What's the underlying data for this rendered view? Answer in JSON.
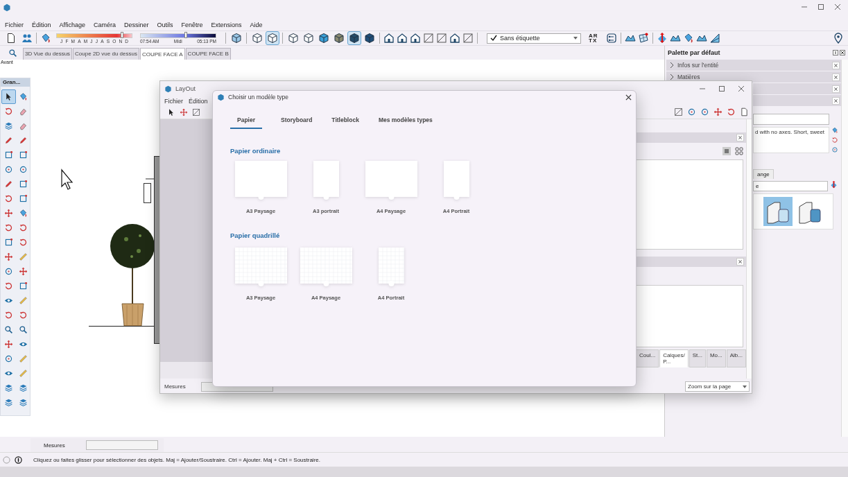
{
  "menu": [
    "Fichier",
    "Édition",
    "Affichage",
    "Caméra",
    "Dessiner",
    "Outils",
    "Fenêtre",
    "Extensions",
    "Aide"
  ],
  "sun_date": {
    "level": 0.87,
    "labels": [
      "J",
      "F",
      "M",
      "A",
      "M",
      "J",
      "J",
      "A",
      "S",
      "O",
      "N",
      "D"
    ]
  },
  "sun_time": {
    "level": 0.6,
    "labels": [
      "07:54 AM",
      "Midi",
      "05:13 PM"
    ]
  },
  "view_buttons": [
    {
      "selected": false
    },
    {
      "selected": false
    },
    {
      "selected": true
    },
    {
      "selected": false
    },
    {
      "selected": false
    },
    {
      "selected": false
    },
    {
      "selected": false
    },
    {
      "selected": true
    },
    {
      "selected": false
    }
  ],
  "tag_dropdown": {
    "value": "Sans étiquette"
  },
  "artx_label": [
    "AR",
    "TX"
  ],
  "scene_tabs": [
    {
      "label": "3D Vue du dessus",
      "selected": false
    },
    {
      "label": "Coupe 2D vue du dessus",
      "selected": false
    },
    {
      "label": "COUPE FACE A",
      "selected": true
    },
    {
      "label": "COUPE FACE B",
      "selected": false
    }
  ],
  "view_name": "Avant",
  "tool_palette": {
    "title": "Gran...",
    "tools": [
      {
        "kind": "cursor",
        "selected": true
      },
      {
        "kind": "paint",
        "selected": false
      },
      {
        "kind": "rotate",
        "selected": false
      },
      {
        "kind": "eraser",
        "selected": false
      },
      {
        "kind": "layers",
        "selected": false
      },
      {
        "kind": "eraser",
        "selected": false
      },
      {
        "kind": "pencil",
        "selected": false
      },
      {
        "kind": "pencil",
        "selected": false
      },
      {
        "kind": "rect",
        "selected": false
      },
      {
        "kind": "rect",
        "selected": false
      },
      {
        "kind": "circle",
        "selected": false
      },
      {
        "kind": "circle",
        "selected": false
      },
      {
        "kind": "pencil",
        "selected": false
      },
      {
        "kind": "rect",
        "selected": false
      },
      {
        "kind": "rotate",
        "selected": false
      },
      {
        "kind": "rect",
        "selected": false
      },
      {
        "kind": "move",
        "selected": false
      },
      {
        "kind": "paint",
        "selected": false
      },
      {
        "kind": "rotate",
        "selected": false
      },
      {
        "kind": "rotate",
        "selected": false
      },
      {
        "kind": "rect",
        "selected": false
      },
      {
        "kind": "rotate",
        "selected": false
      },
      {
        "kind": "move",
        "selected": false
      },
      {
        "kind": "tape",
        "selected": false
      },
      {
        "kind": "circle",
        "selected": false
      },
      {
        "kind": "move",
        "selected": false
      },
      {
        "kind": "rotate",
        "selected": false
      },
      {
        "kind": "rect",
        "selected": false
      },
      {
        "kind": "eye",
        "selected": false
      },
      {
        "kind": "tape",
        "selected": false
      },
      {
        "kind": "rotate",
        "selected": false
      },
      {
        "kind": "rotate",
        "selected": false
      },
      {
        "kind": "search",
        "selected": false
      },
      {
        "kind": "search",
        "selected": false
      },
      {
        "kind": "move",
        "selected": false
      },
      {
        "kind": "eye",
        "selected": false
      },
      {
        "kind": "circle",
        "selected": false
      },
      {
        "kind": "tape",
        "selected": false
      },
      {
        "kind": "eye",
        "selected": false
      },
      {
        "kind": "tape",
        "selected": false
      },
      {
        "kind": "layers",
        "selected": false
      },
      {
        "kind": "layers",
        "selected": false
      },
      {
        "kind": "layers",
        "selected": false
      },
      {
        "kind": "layers",
        "selected": false
      }
    ]
  },
  "tray": {
    "title": "Palette par défaut",
    "panels": [
      {
        "label": "Infos sur l'entité",
        "expanded": false
      },
      {
        "label": "Matières",
        "expanded": false
      }
    ]
  },
  "style_panel": {
    "description": "d with no axes. Short, sweet",
    "tab": "ange",
    "dropdown": "e",
    "thumbnails": [
      {
        "selected": true
      },
      {
        "selected": false
      }
    ]
  },
  "measurements": {
    "label": "Mesures"
  },
  "status": "Cliquez ou faites glisser pour sélectionner des objets. Maj = Ajouter/Soustraire. Ctrl = Ajouter. Maj + Ctrl = Soustraire.",
  "layout_window": {
    "title": "LayOut",
    "menu": [
      "Fichier",
      "Édition"
    ],
    "tray_tabs": [
      {
        "label": "Coul...",
        "selected": false
      },
      {
        "label": "Calques/ P...",
        "selected": true
      },
      {
        "label": "St...",
        "selected": false
      },
      {
        "label": "Mo...",
        "selected": false
      },
      {
        "label": "Alb...",
        "selected": false
      }
    ],
    "measurements_label": "Mesures",
    "zoom": "Zoom sur la page"
  },
  "dialog": {
    "title": "Choisir un modèle type",
    "tabs": [
      {
        "label": "Papier",
        "selected": true
      },
      {
        "label": "Storyboard",
        "selected": false
      },
      {
        "label": "Titleblock",
        "selected": false
      },
      {
        "label": "Mes modèles types",
        "selected": false
      }
    ],
    "sections": [
      {
        "title": "Papier ordinaire",
        "kind": "plain",
        "templates": [
          {
            "label": "A3 Paysage",
            "kind": "landscape"
          },
          {
            "label": "A3 portrait",
            "kind": "portrait"
          },
          {
            "label": "A4 Paysage",
            "kind": "landscape"
          },
          {
            "label": "A4 Portrait",
            "kind": "portrait"
          }
        ]
      },
      {
        "title": "Papier quadrillé",
        "kind": "grid",
        "templates": [
          {
            "label": "A3 Paysage",
            "kind": "landscape"
          },
          {
            "label": "A4 Paysage",
            "kind": "landscape"
          },
          {
            "label": "A4 Portrait",
            "kind": "portrait"
          }
        ]
      }
    ]
  }
}
